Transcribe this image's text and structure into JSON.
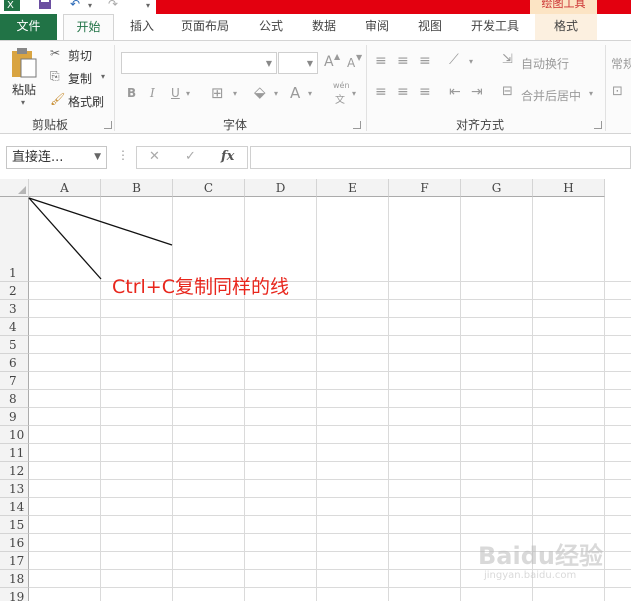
{
  "title_bar": {
    "context_tab": "绘图工具"
  },
  "tabs": [
    {
      "label": "文件"
    },
    {
      "label": "开始"
    },
    {
      "label": "插入"
    },
    {
      "label": "页面布局"
    },
    {
      "label": "公式"
    },
    {
      "label": "数据"
    },
    {
      "label": "审阅"
    },
    {
      "label": "视图"
    },
    {
      "label": "开发工具"
    },
    {
      "label": "格式"
    }
  ],
  "ribbon": {
    "clipboard": {
      "paste": "粘贴",
      "cut": "剪切",
      "copy": "复制",
      "format_painter": "格式刷",
      "group": "剪贴板"
    },
    "font": {
      "bold": "B",
      "italic": "I",
      "underline": "U",
      "grow": "A",
      "shrink": "A",
      "font_color": "A",
      "phonetic_top": "wén",
      "phonetic_bottom": "文",
      "group": "字体"
    },
    "alignment": {
      "wrap_text": "自动换行",
      "merge_center": "合并后居中",
      "group": "对齐方式"
    },
    "number": {
      "format": "常规"
    }
  },
  "formula_bar": {
    "name_box": "直接连...",
    "fx": "fx",
    "cancel": "✕",
    "enter": "✓"
  },
  "sheet": {
    "columns": [
      "A",
      "B",
      "C",
      "D",
      "E",
      "F",
      "G",
      "H"
    ],
    "rows": [
      "1",
      "2",
      "3",
      "4",
      "5",
      "6",
      "7",
      "8",
      "9",
      "10",
      "11",
      "12",
      "13",
      "14",
      "15",
      "16",
      "17",
      "18",
      "19"
    ],
    "annotation": "Ctrl+C复制同样的线"
  },
  "watermark": {
    "text": "Baidu经验",
    "url": "jingyan.baidu.com"
  },
  "colors": {
    "file_tab": "#217346",
    "title_red": "#e3000f",
    "annotation": "#e8261c"
  }
}
